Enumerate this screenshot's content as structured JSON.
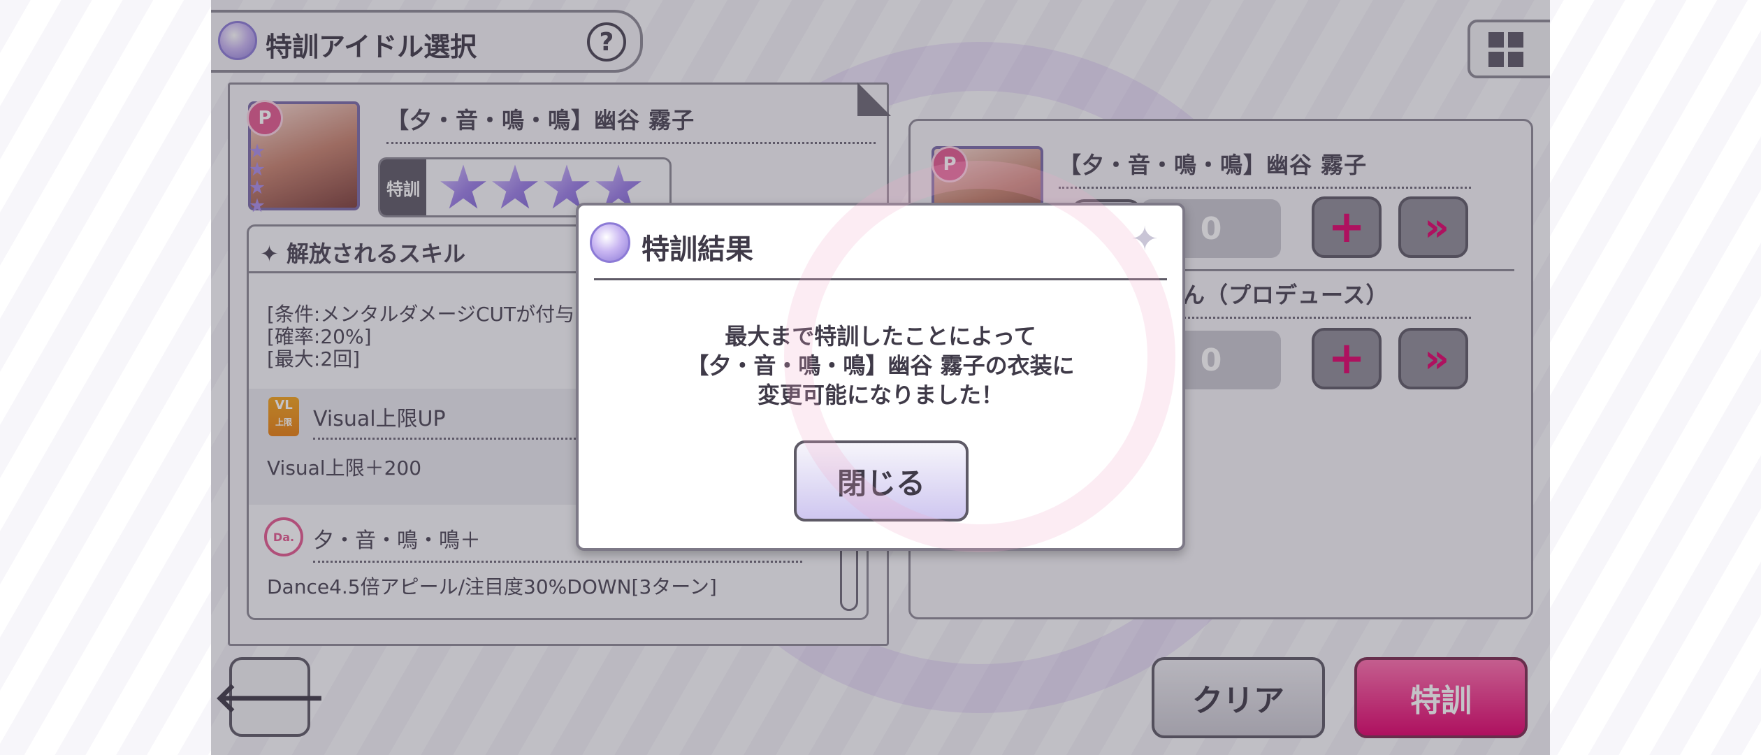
{
  "header": {
    "title": "特訓アイドル選択",
    "help_symbol": "?"
  },
  "left_panel": {
    "card_name": "【夕・音・鳴・鳴】幽谷 霧子",
    "badge_letter": "P",
    "tokkun_label": "特訓",
    "stars": 4,
    "skills_header": "✦ 解放されるスキル",
    "skill_conditions": [
      "[条件:メンタルダメージCUTが付与",
      "[確率:20%]",
      "[最大:2回]"
    ],
    "skill_visual": {
      "icon_text": "VL",
      "icon_sub": "上限",
      "name": "Visual上限UP",
      "desc": "Visual上限＋200"
    },
    "skill_dance": {
      "icon_text": "Da.",
      "name": "夕・音・鳴・鳴＋",
      "desc": "Dance4.5倍アピール/注目度30%DOWN[3ターン]"
    }
  },
  "right_panel": {
    "card_name": "【夕・音・鳴・鳴】幽谷 霧子",
    "badge_letter": "P",
    "row1_value": "0",
    "row2_label": "づきさん（プロデュース）",
    "row2_value": "0",
    "plus_symbol": "+",
    "fast_symbol": "»"
  },
  "bottom": {
    "back_symbol": "🡐",
    "clear_label": "クリア",
    "train_label": "特訓"
  },
  "dialog": {
    "title": "特訓結果",
    "sparkle": "✦",
    "message": [
      "最大まで特訓したことによって",
      "【夕・音・鳴・鳴】幽谷 霧子の衣装に",
      "変更可能になりました！"
    ],
    "close_label": "閉じる"
  },
  "colors": {
    "accent_pink": "#e0006b",
    "accent_purple": "#8c7ad6",
    "frame_gray": "#8c8894"
  }
}
